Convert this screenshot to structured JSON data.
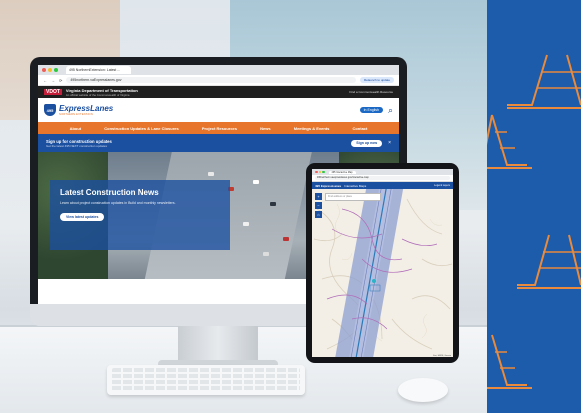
{
  "colors": {
    "brand_blue": "#1b4fa0",
    "brand_orange": "#e7752b",
    "panel_blue": "#1c5cab",
    "cone_stroke": "#e98a3c"
  },
  "browser": {
    "tab_title": "495 NorthernExtension: Latest ...",
    "url": "495northern.vaExpresslanes.gov",
    "relaunch_label": "Relaunch to update"
  },
  "vdot": {
    "logo": "VDOT",
    "title": "Virginia Department of Transportation",
    "subtitle": "An official website of the Commonwealth of Virginia",
    "find": "Find a Commonwealth Resource"
  },
  "site": {
    "shield": "495",
    "logo_main": "ExpressLanes",
    "logo_tag": "NORTHERN EXTENSION",
    "lang_button": "In English",
    "nav": [
      "About",
      "Construction Updates & Lane Closures",
      "Project Resources",
      "News",
      "Meetings & Events",
      "Contact"
    ],
    "signup_title": "Sign up for construction updates",
    "signup_sub": "Get the latest 495 NEXT construction updates",
    "signup_button": "Sign up now",
    "hero_title": "Latest Construction News",
    "hero_sub": "Learn about project construction updates in Build and monthly newsletters.",
    "hero_button": "View latest updates"
  },
  "tablet": {
    "tab_title": "495 Interactive Map",
    "url": "495northern.vaexpresslanes.gov/interactive-map",
    "map_logo": "495 ExpressLanes",
    "map_title": "Interactive Maps",
    "map_nav": "Legend  Layers",
    "search_placeholder": "Find address or place",
    "credit": "Esri, HERE, Garmin"
  }
}
